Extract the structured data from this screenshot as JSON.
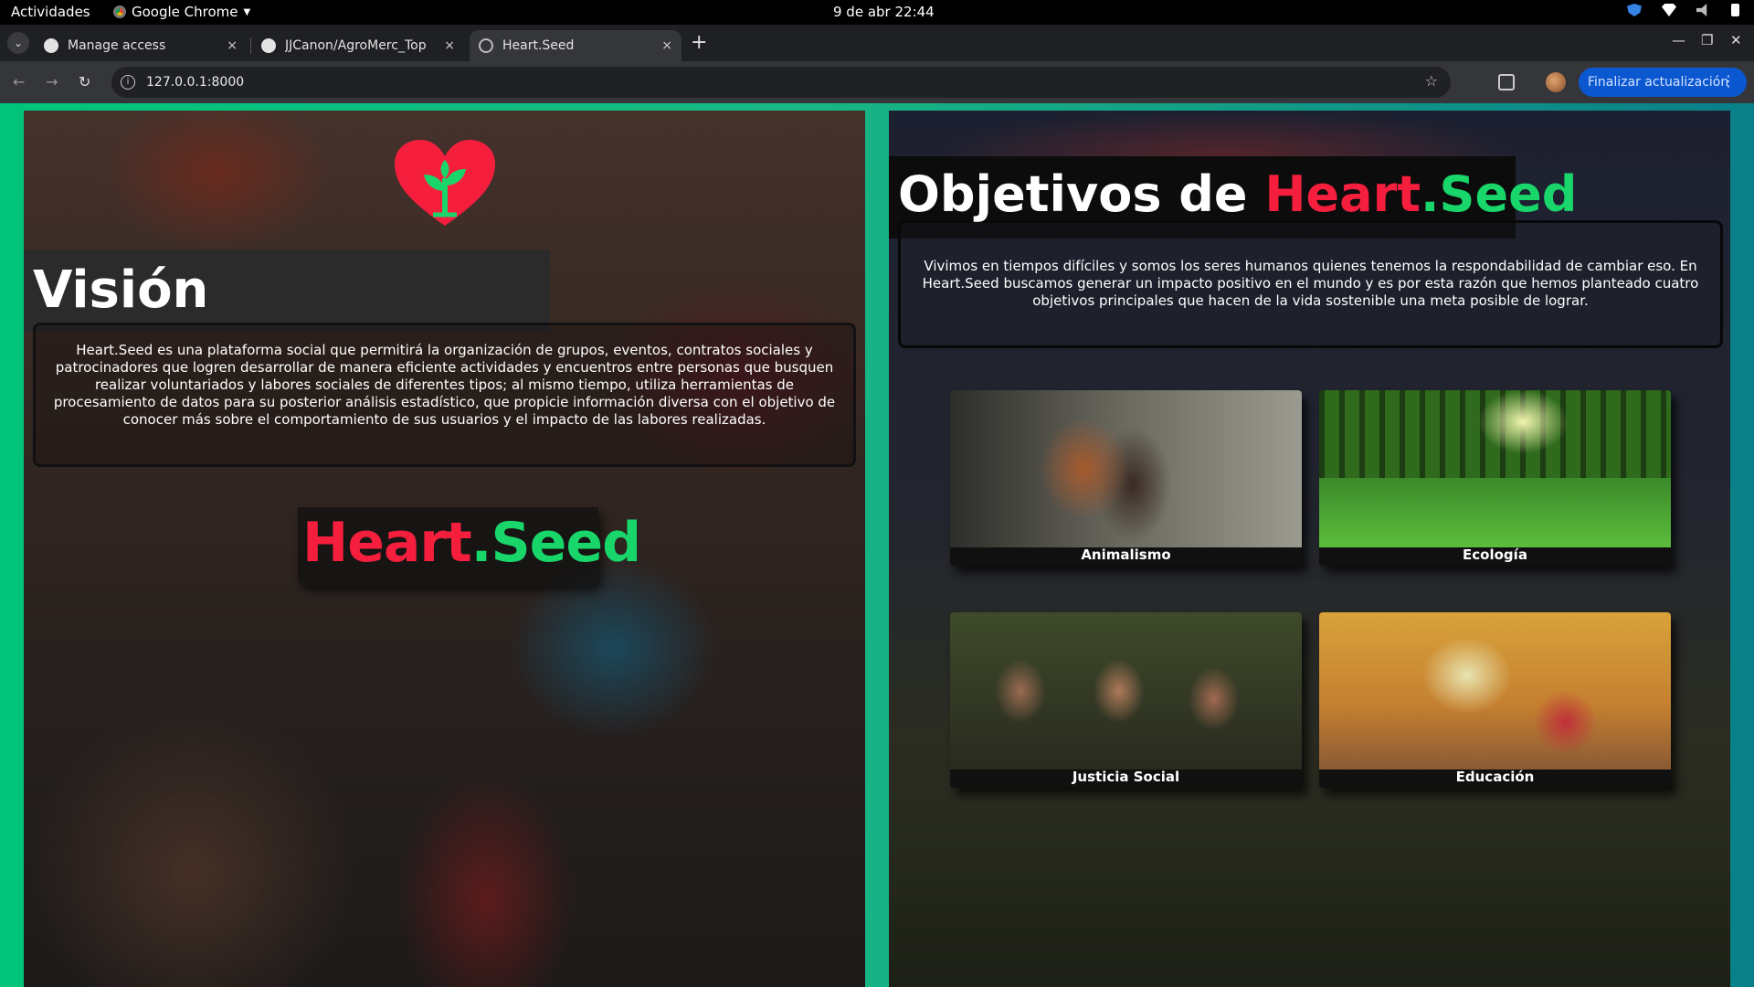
{
  "os": {
    "activities": "Actividades",
    "app_name": "Google Chrome",
    "clock": "9 de abr  22:44"
  },
  "browser": {
    "tabs": [
      {
        "title": "Manage access",
        "close": "×"
      },
      {
        "title": "JJCanon/AgroMerc_Top",
        "close": "×"
      },
      {
        "title": "Heart.Seed",
        "close": "×"
      }
    ],
    "new_tab": "+",
    "url": "127.0.0.1:8000",
    "update_button": "Finalizar actualización"
  },
  "vision": {
    "title": "Visión",
    "text": "Heart.Seed es una plataforma social que permitirá la organización de grupos, eventos, contratos sociales y patrocinadores que logren desarrollar de manera eficiente actividades y encuentros entre personas que busquen realizar voluntariados y labores sociales de diferentes tipos; al mismo tiempo, utiliza herramientas de procesamiento de datos para su posterior análisis estadístico, que propicie información diversa con el objetivo de conocer más sobre el comportamiento de sus usuarios y el impacto de las labores realizadas.",
    "brand_part1": "Heart",
    "brand_part2": ".Seed"
  },
  "objetivos": {
    "title_prefix": "Objetivos de ",
    "title_brand1": "Heart",
    "title_brand2": ".Seed",
    "text": "Vivimos en tiempos difíciles y somos los seres humanos quienes tenemos la respondabilidad de cambiar eso. En Heart.Seed buscamos generar un impacto positivo en el mundo y es por esta razón que hemos planteado cuatro objetivos principales que hacen de la vida sostenible una meta posible de lograr.",
    "cards": [
      {
        "label": "Animalismo"
      },
      {
        "label": "Ecología"
      },
      {
        "label": "Justicia Social"
      },
      {
        "label": "Educación"
      }
    ]
  },
  "colors": {
    "brand_red": "#f51f3d",
    "brand_green": "#19d66a",
    "page_gradient_start": "#00c47a",
    "page_gradient_end": "#0a7f89"
  },
  "icons": [
    "heart-seed-logo-icon",
    "github-icon",
    "globe-icon",
    "info-icon",
    "star-icon",
    "extension-icon"
  ]
}
